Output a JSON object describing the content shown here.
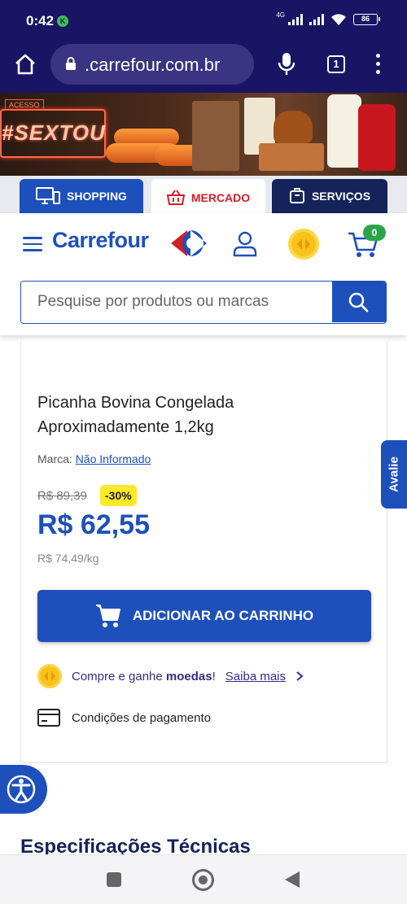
{
  "status_bar": {
    "time": "0:42",
    "network": "4G",
    "battery": "86"
  },
  "browser": {
    "url": ".carrefour.com.br",
    "tab_count": "1"
  },
  "banner": {
    "headline": "#SEXTOU",
    "tag": "ACESSO"
  },
  "category_tabs": [
    {
      "label": "SHOPPING",
      "icon": "monitor-phone-icon"
    },
    {
      "label": "MERCADO",
      "icon": "basket-icon",
      "active": true
    },
    {
      "label": "SERVIÇOS",
      "icon": "service-box-icon"
    }
  ],
  "header": {
    "brand": "Carrefour",
    "cart_count": "0",
    "search_placeholder": "Pesquise por produtos ou marcas"
  },
  "product": {
    "title": "Picanha Bovina Congelada Aproximadamente 1,2kg",
    "brand_label": "Marca:",
    "brand_value": "Não Informado",
    "old_price": "R$ 89,39",
    "discount": "-30%",
    "price": "R$ 62,55",
    "price_per_kg": "R$ 74,49/kg",
    "add_to_cart": "ADICIONAR AO CARRINHO",
    "coins_prefix": "Compre e ganhe",
    "coins_bold": "moedas",
    "coins_suffix": "!",
    "coins_link": "Saiba mais",
    "payment_conditions": "Condições de pagamento"
  },
  "avalie": "Avalie",
  "specs_title": "Especificações Técnicas",
  "colors": {
    "brand_blue": "#1e50bc",
    "navy": "#1a1464",
    "promo_yellow": "#ffe92a",
    "mercado_red": "#d0202a",
    "badge_green": "#2ca34a"
  }
}
